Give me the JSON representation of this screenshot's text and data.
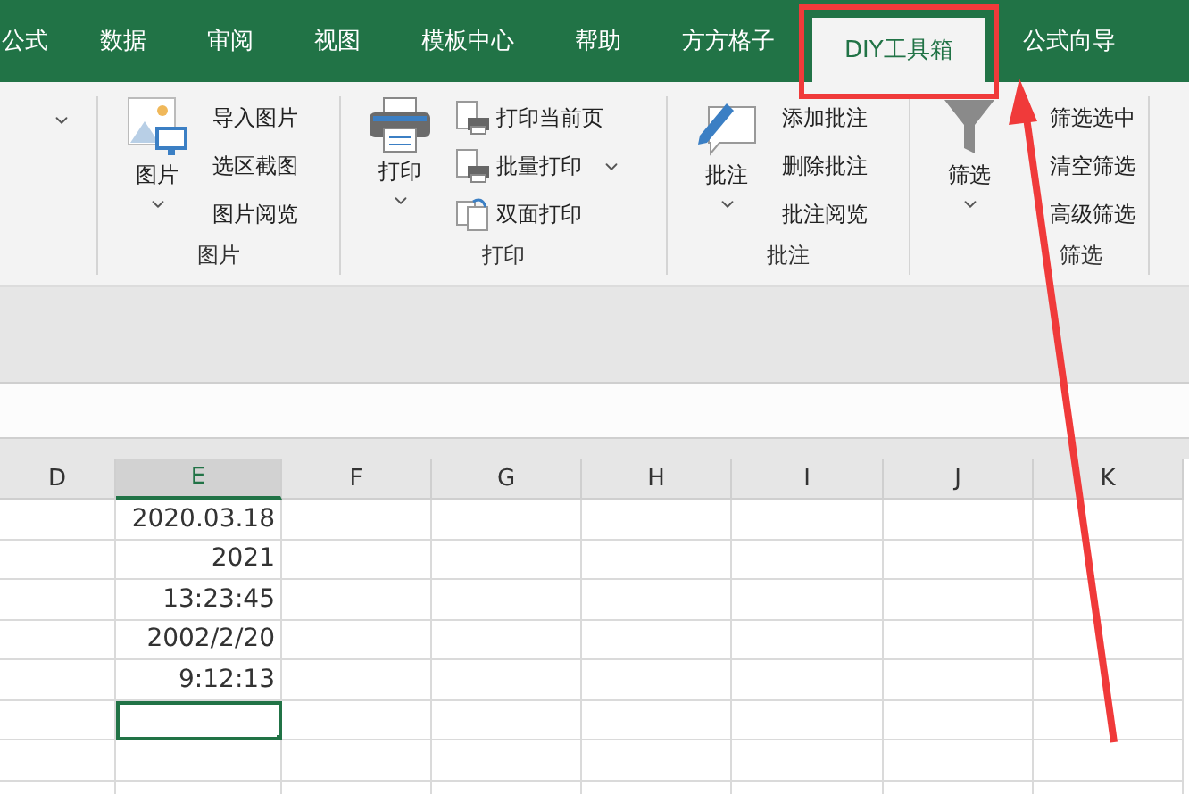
{
  "tabs": [
    {
      "label": "公式",
      "selected": false
    },
    {
      "label": "数据",
      "selected": false
    },
    {
      "label": "审阅",
      "selected": false
    },
    {
      "label": "视图",
      "selected": false
    },
    {
      "label": "模板中心",
      "selected": false
    },
    {
      "label": "帮助",
      "selected": false
    },
    {
      "label": "方方格子",
      "selected": false
    },
    {
      "label": "DIY工具箱",
      "selected": true
    },
    {
      "label": "公式向导",
      "selected": false
    }
  ],
  "ribbon": {
    "groups": [
      {
        "label": "图片",
        "big": {
          "label": "图片",
          "kind": "picture",
          "has_menu": true
        },
        "items": [
          {
            "label": "导入图片",
            "has_menu": false
          },
          {
            "label": "选区截图",
            "has_menu": false
          },
          {
            "label": "图片阅览",
            "has_menu": false
          }
        ]
      },
      {
        "label": "打印",
        "big": {
          "label": "打印",
          "kind": "printer",
          "has_menu": true
        },
        "items": [
          {
            "label": "打印当前页",
            "kind": "page",
            "has_menu": false
          },
          {
            "label": "批量打印",
            "kind": "page",
            "has_menu": true
          },
          {
            "label": "双面打印",
            "kind": "duplex",
            "has_menu": false
          }
        ]
      },
      {
        "label": "批注",
        "big": {
          "label": "批注",
          "kind": "comment",
          "has_menu": true
        },
        "items": [
          {
            "label": "添加批注",
            "has_menu": false
          },
          {
            "label": "删除批注",
            "has_menu": false
          },
          {
            "label": "批注阅览",
            "has_menu": false
          }
        ]
      },
      {
        "label": "筛选",
        "big": {
          "label": "筛选",
          "kind": "filter",
          "has_menu": true
        },
        "items": [
          {
            "label": "筛选选中",
            "has_menu": false
          },
          {
            "label": "清空筛选",
            "has_menu": false
          },
          {
            "label": "高级筛选",
            "has_menu": false
          }
        ]
      }
    ]
  },
  "columns": [
    {
      "label": "D",
      "selected": false
    },
    {
      "label": "E",
      "selected": true
    },
    {
      "label": "F",
      "selected": false
    },
    {
      "label": "G",
      "selected": false
    },
    {
      "label": "H",
      "selected": false
    },
    {
      "label": "I",
      "selected": false
    },
    {
      "label": "J",
      "selected": false
    },
    {
      "label": "K",
      "selected": false
    }
  ],
  "rows": [
    {
      "e": "2020.03.18",
      "selected": false
    },
    {
      "e": "2021",
      "selected": false
    },
    {
      "e": "13:23:45",
      "selected": false
    },
    {
      "e": "2002/2/20",
      "selected": false
    },
    {
      "e": "9:12:13",
      "selected": false
    },
    {
      "selected": true
    },
    {
      "selected": false
    },
    {
      "selected": false
    }
  ]
}
